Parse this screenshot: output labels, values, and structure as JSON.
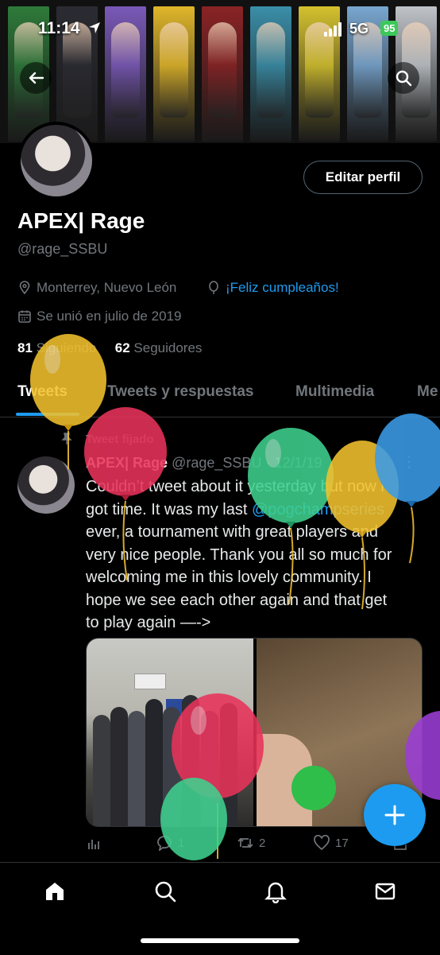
{
  "status": {
    "time": "11:14",
    "network": "5G",
    "battery": "95"
  },
  "banner": {
    "panel_colors": [
      "#2e7a3a",
      "#2b2b33",
      "#7a59b8",
      "#e0b62a",
      "#8a2325",
      "#3a8ea8",
      "#d4c12e",
      "#78a6d0",
      "#bfc4c9"
    ]
  },
  "profile": {
    "edit_button": "Editar perfil",
    "name": "APEX| Rage",
    "handle": "@rage_SSBU",
    "location": "Monterrey, Nuevo León",
    "birthday": "¡Feliz cumpleaños!",
    "joined": "Se unió en julio de 2019",
    "following_count": "81",
    "following_label": "Siguiendo",
    "followers_count": "62",
    "followers_label": "Seguidores"
  },
  "tabs": [
    {
      "label": "Tweets"
    },
    {
      "label": "Tweets y respuestas"
    },
    {
      "label": "Multimedia"
    },
    {
      "label": "Me"
    }
  ],
  "tweet": {
    "pinned_label": "Tweet fijado",
    "author": "APEX| Rage",
    "handle": "@rage_SSBU",
    "date": "· 12/1/19",
    "text_lines": [
      "Couldn’t tweet about it yesterday but now i",
      "got time. It was my last ",
      "ever, a tournament with great players and",
      "very nice people. Thank you all so much for",
      "welcoming me in this lovely community. I",
      "hope we see each other again and that get",
      "to play again —->"
    ],
    "mention": "@pogchampseries",
    "replies": "1",
    "retweets": "2",
    "likes": "17"
  },
  "icons": {
    "back": "back-arrow-icon",
    "search": "search-icon",
    "location": "location-pin-icon",
    "balloon": "balloon-icon",
    "calendar": "calendar-icon",
    "pin": "pin-icon",
    "home": "home-icon",
    "explore": "search-icon",
    "notifications": "bell-icon",
    "messages": "mail-icon",
    "compose": "plus-icon"
  },
  "colors": {
    "accent": "#1d9bf0",
    "muted": "#71767b",
    "battery": "#3cc85a"
  }
}
